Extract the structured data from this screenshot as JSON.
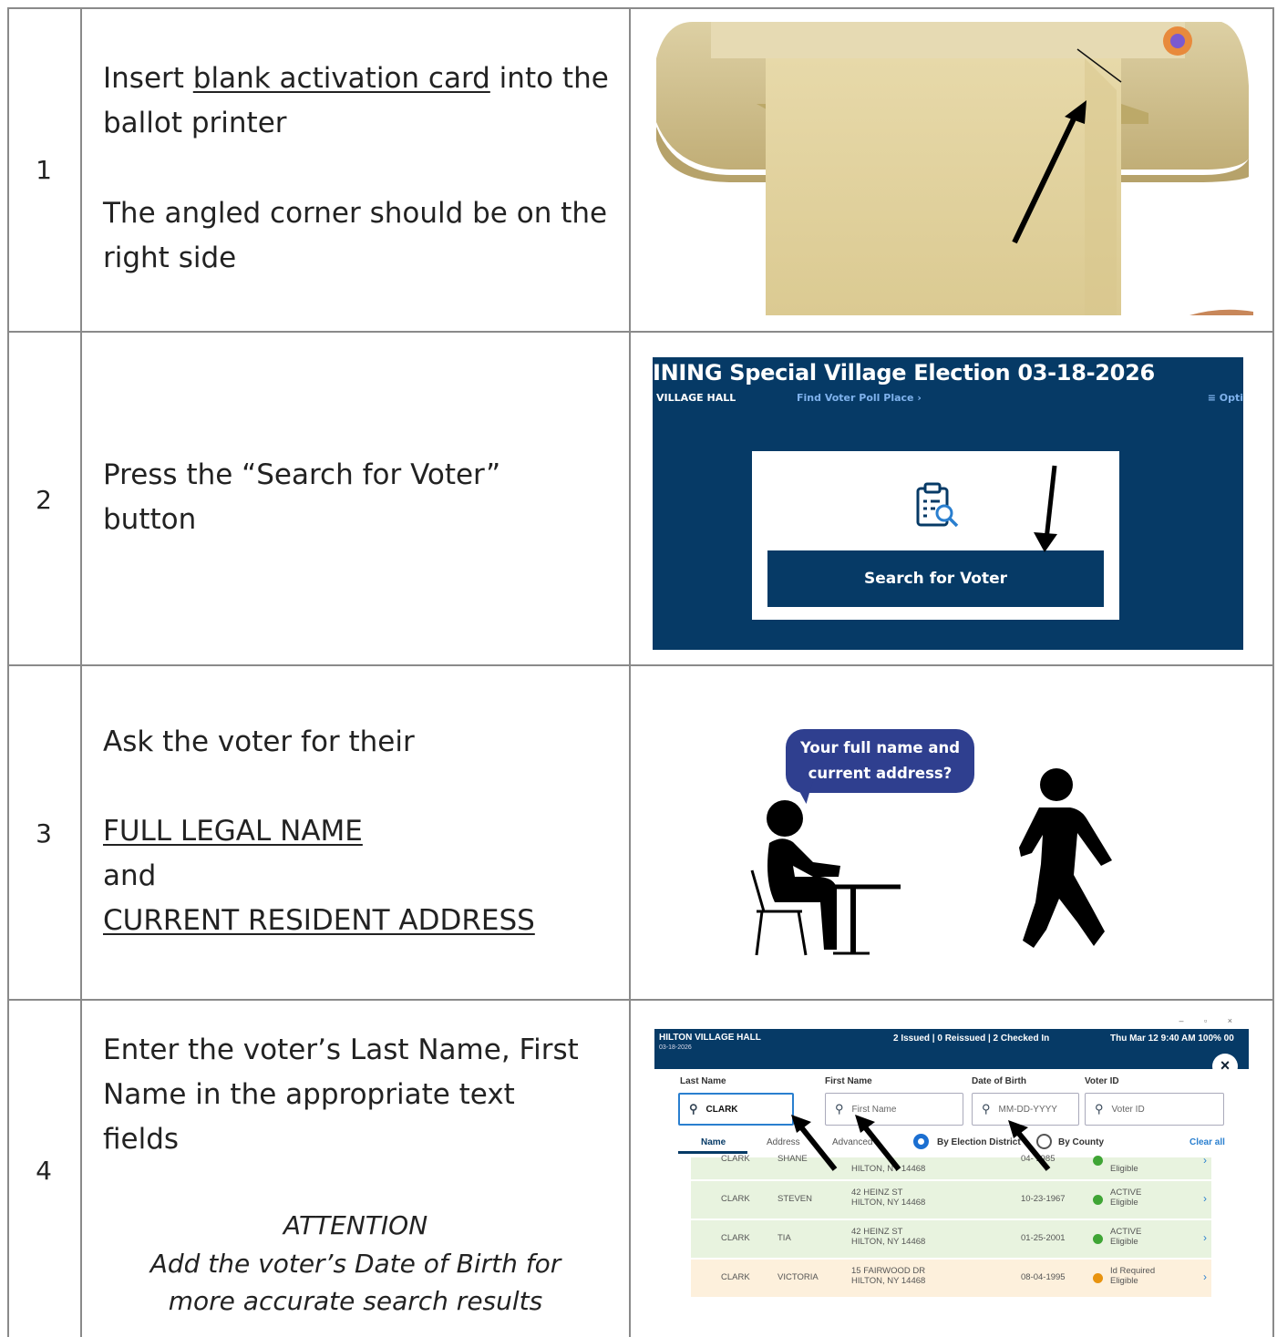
{
  "rows": [
    {
      "number": "1",
      "lines": {
        "a_pre": "Insert ",
        "a_link": "blank activation card",
        "a_post": " into the ballot printer",
        "b": "The angled corner should be on the right side"
      },
      "icon": "ballot-printer-photo"
    },
    {
      "number": "2",
      "text": "Press the “Search for Voter” button",
      "screen": {
        "title": "INING Special Village Election 03-18-2026",
        "location": "VILLAGE HALL",
        "find_link": "Find Voter Poll Place ›",
        "options": "≡ Opti",
        "button": "Search for Voter",
        "icon": "clipboard-search-icon"
      }
    },
    {
      "number": "3",
      "text_intro": "Ask the voter for their",
      "name_req": "FULL LEGAL NAME",
      "and": "and",
      "address_req": "CURRENT RESIDENT ADDRESS",
      "bubble": "Your full name and current address?"
    },
    {
      "number": "4",
      "text": "Enter the voter’s Last Name, First Name in the appropriate text fields",
      "attention_title": "ATTENTION",
      "attention_body": "Add the voter’s Date of Birth for more accurate search results",
      "screen": {
        "hall": "HILTON VILLAGE HALL",
        "date": "03-18-2026",
        "status": "2 Issued | 0 Reissued | 2 Checked In",
        "clock": "Thu Mar 12  9:40 AM  100% 00",
        "labels": {
          "last": "Last Name",
          "first": "First Name",
          "dob": "Date of Birth",
          "voter_id": "Voter ID"
        },
        "last_value": "CLARK",
        "first_placeholder": "First Name",
        "dob_placeholder": "MM-DD-YYYY",
        "id_placeholder": "Voter ID",
        "tabs": [
          "Name",
          "Address",
          "Advanced"
        ],
        "radio_district": "By Election District",
        "radio_county": "By County",
        "clear": "Clear all",
        "results": [
          {
            "last": "CLARK",
            "first": "SHANE",
            "addr1": "",
            "addr2": "HILTON, NY 14468",
            "dob": "04-  1985",
            "status1": "",
            "status2": "Eligible",
            "color": "#e8f3df",
            "dot": "#3fa535"
          },
          {
            "last": "CLARK",
            "first": "STEVEN",
            "addr1": "42 HEINZ ST",
            "addr2": "HILTON, NY 14468",
            "dob": "10-23-1967",
            "status1": "ACTIVE",
            "status2": "Eligible",
            "color": "#e8f3df",
            "dot": "#3fa535"
          },
          {
            "last": "CLARK",
            "first": "TIA",
            "addr1": "42 HEINZ ST",
            "addr2": "HILTON, NY 14468",
            "dob": "01-25-2001",
            "status1": "ACTIVE",
            "status2": "Eligible",
            "color": "#e8f3df",
            "dot": "#3fa535"
          },
          {
            "last": "CLARK",
            "first": "VICTORIA",
            "addr1": "15 FAIRWOOD DR",
            "addr2": "HILTON, NY 14468",
            "dob": "08-04-1995",
            "status1": "Id Required",
            "status2": "Eligible",
            "color": "#fdf0dc",
            "dot": "#e8930f"
          }
        ]
      }
    }
  ],
  "colors": {
    "navy": "#063a66",
    "bubble": "#2f3f8f",
    "grid": "#8a8a8a"
  }
}
